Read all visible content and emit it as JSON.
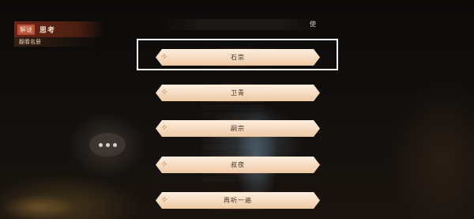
{
  "hud": {
    "tag": "解谜",
    "chapter": "思考",
    "subtitle": "翻看名册"
  },
  "dialogue": {
    "visible_text": "使"
  },
  "choices": [
    {
      "label": "石崇",
      "selected": true
    },
    {
      "label": "卫青",
      "selected": false
    },
    {
      "label": "嗣宗",
      "selected": false
    },
    {
      "label": "叔夜",
      "selected": false
    },
    {
      "label": "再听一遍",
      "selected": false
    }
  ],
  "colors": {
    "choice_fill": "#f6dcc3",
    "choice_glow": "#eb7837",
    "tag_bg": "#b8533a",
    "selector_border": "#ffffff"
  },
  "icons": {
    "choice_ornament": "sparkle-icon",
    "bubble": "ellipsis-icon"
  }
}
